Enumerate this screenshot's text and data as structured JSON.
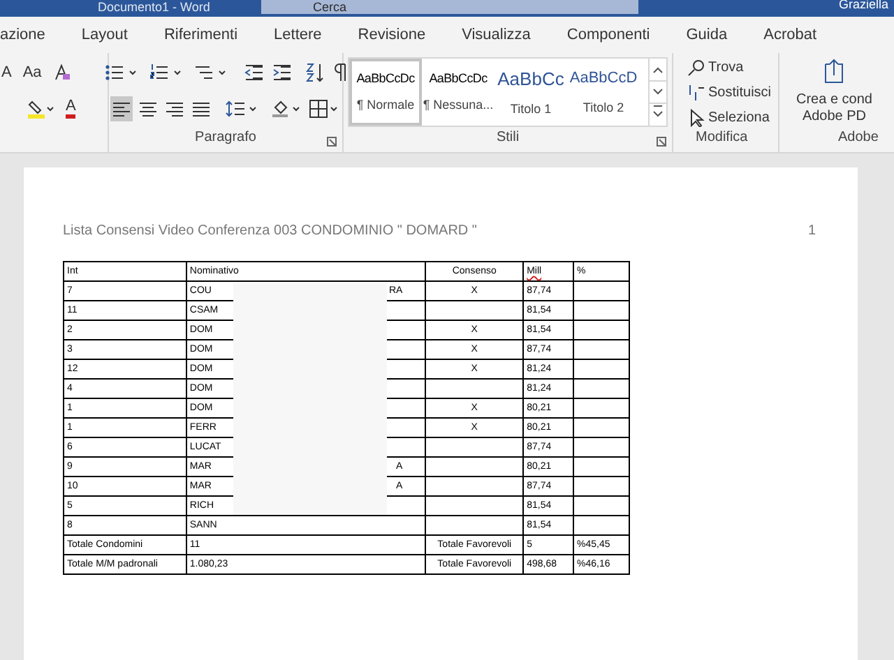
{
  "title_bar": {
    "title": "Documento1 - Word",
    "search_placeholder": "Cerca",
    "user": "Graziella"
  },
  "tabs": [
    {
      "label": "azione",
      "selected": false
    },
    {
      "label": "Layout",
      "selected": false
    },
    {
      "label": "Riferimenti",
      "selected": false
    },
    {
      "label": "Lettere",
      "selected": false
    },
    {
      "label": "Revisione",
      "selected": false
    },
    {
      "label": "Visualizza",
      "selected": false
    },
    {
      "label": "Componenti",
      "selected": false
    },
    {
      "label": "Guida",
      "selected": false
    },
    {
      "label": "Acrobat",
      "selected": false
    }
  ],
  "font_group": {
    "grow_glyph": "A",
    "case_glyph": "Aa",
    "color_glyph": "A"
  },
  "paragraph": {
    "label": "Paragrafo",
    "alignments": [
      {
        "kind": "left",
        "selected": true
      },
      {
        "kind": "center",
        "selected": false
      },
      {
        "kind": "right",
        "selected": false
      },
      {
        "kind": "justify",
        "selected": false
      }
    ]
  },
  "styles": {
    "label": "Stili",
    "items": [
      {
        "sample": "AaBbCcDc",
        "name": "¶ Normale",
        "kind": "body",
        "selected": true
      },
      {
        "sample": "AaBbCcDc",
        "name": "¶ Nessuna...",
        "kind": "body",
        "selected": false
      },
      {
        "sample": "AaBbCc",
        "name": "Titolo 1",
        "kind": "heading",
        "selected": false
      },
      {
        "sample": "AaBbCcD",
        "name": "Titolo 2",
        "kind": "heading2",
        "selected": false
      }
    ]
  },
  "modifica": {
    "label": "Modifica",
    "items": [
      {
        "kind": "find",
        "label": "Trova"
      },
      {
        "kind": "replace",
        "label": "Sostituisci"
      },
      {
        "kind": "select",
        "label": "Seleziona"
      }
    ]
  },
  "adobe": {
    "label": "Adobe",
    "button_lines": [
      "Crea e cond",
      "Adobe PD"
    ]
  },
  "document": {
    "heading": "Lista Consensi Video Conferenza 003 CONDOMINIO \" DOMARD \"",
    "page_number": "1",
    "table": {
      "columns": [
        "Int",
        "Nominativo",
        "Consenso",
        "Mill",
        "%"
      ],
      "rows": [
        {
          "int": "7",
          "name_start": "COU",
          "name_end": "RA",
          "consenso": "X",
          "mill": "87,74",
          "pct": ""
        },
        {
          "int": "11",
          "name_start": "CSAM",
          "name_end": "",
          "consenso": "",
          "mill": "81,54",
          "pct": ""
        },
        {
          "int": "2",
          "name_start": "DOM",
          "name_end": "",
          "consenso": "X",
          "mill": "81,54",
          "pct": ""
        },
        {
          "int": "3",
          "name_start": "DOM",
          "name_end": "",
          "consenso": "X",
          "mill": "87,74",
          "pct": ""
        },
        {
          "int": "12",
          "name_start": "DOM",
          "name_end": "",
          "consenso": "X",
          "mill": "81,24",
          "pct": ""
        },
        {
          "int": "4",
          "name_start": "DOM",
          "name_end": "",
          "consenso": "",
          "mill": "81,24",
          "pct": ""
        },
        {
          "int": "1",
          "name_start": "DOM",
          "name_end": "",
          "consenso": "X",
          "mill": "80,21",
          "pct": ""
        },
        {
          "int": "1",
          "name_start": "FERR",
          "name_end": "",
          "consenso": "X",
          "mill": "80,21",
          "pct": ""
        },
        {
          "int": "6",
          "name_start": "LUCAT",
          "name_end": "",
          "consenso": "",
          "mill": "87,74",
          "pct": ""
        },
        {
          "int": "9",
          "name_start": "MAR",
          "name_end": "A",
          "consenso": "",
          "mill": "80,21",
          "pct": ""
        },
        {
          "int": "10",
          "name_start": "MAR",
          "name_end": "A",
          "consenso": "",
          "mill": "87,74",
          "pct": ""
        },
        {
          "int": "5",
          "name_start": "RICH",
          "name_end": "",
          "consenso": "",
          "mill": "81,54",
          "pct": ""
        },
        {
          "int": "8",
          "name_start": "SANN",
          "name_end": "",
          "consenso": "",
          "mill": "81,54",
          "pct": ""
        }
      ],
      "totals": [
        {
          "label": "Totale Condomini",
          "value": "11",
          "label2": "Totale Favorevoli",
          "mill": "5",
          "pct": "%45,45"
        },
        {
          "label": "Totale M/M padronali",
          "value": "1.080,23",
          "label2": "Totale Favorevoli",
          "mill": "498,68",
          "pct": "%46,16"
        }
      ]
    }
  }
}
